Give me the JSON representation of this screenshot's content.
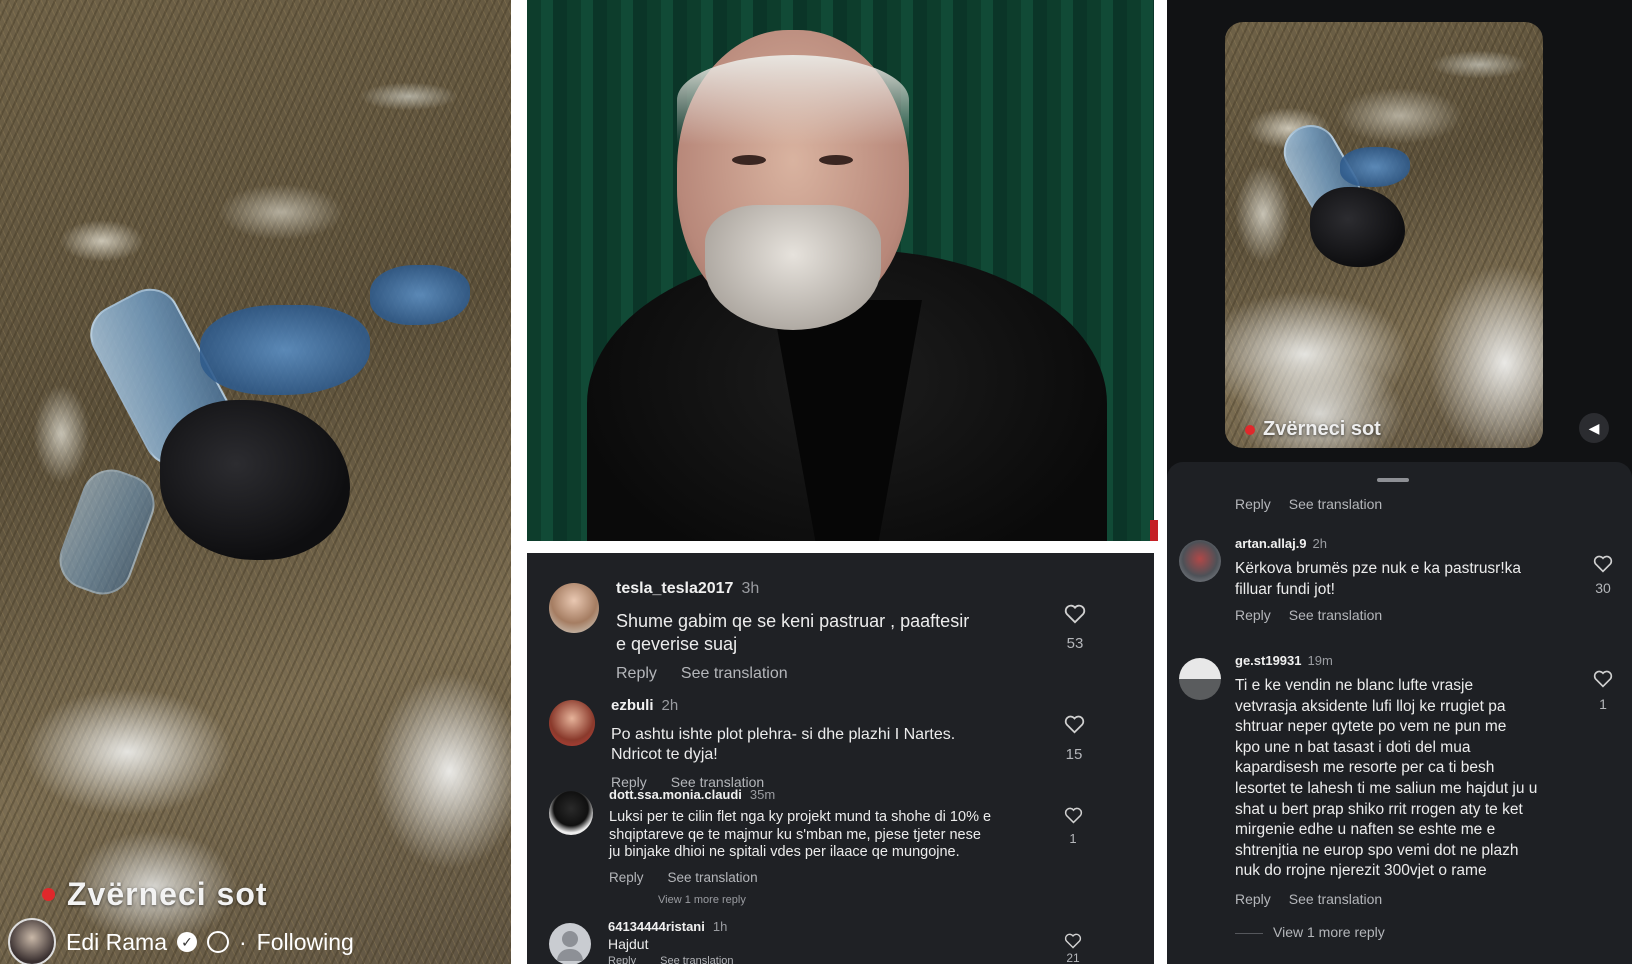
{
  "left_panel": {
    "location_label": "Zvërneci sot",
    "author": "Edi Rama",
    "separator": "·",
    "follow_status": "Following"
  },
  "middle_comments": [
    {
      "user": "tesla_tesla2017",
      "time": "3h",
      "text_lines": [
        "Shume gabim qe se keni pastruar , paaftesir",
        "e qeverise suaj"
      ],
      "likes": "53",
      "reply": "Reply",
      "translate": "See translation"
    },
    {
      "user": "ezbuli",
      "time": "2h",
      "text_lines": [
        "Po ashtu ishte plot plehra- si dhe plazhi I Nartes.",
        "Ndricot te dyja!"
      ],
      "likes": "15",
      "reply": "Reply",
      "translate": "See translation"
    },
    {
      "user": "dott.ssa.monia.claudi",
      "time": "35m",
      "text_lines": [
        "Luksi per te cilin flet nga ky projekt mund ta shohe di 10% e",
        "shqiptareve qe te majmur ku s'mban me, pjese tjeter nese",
        "ju binjake dhioi ne spitali vdes per ilaace qe mungojne."
      ],
      "likes": "1",
      "reply": "Reply",
      "translate": "See translation",
      "view_more": "View 1 more reply"
    },
    {
      "user": "64134444ristani",
      "time": "1h",
      "text_lines": [
        "Hajdut"
      ],
      "likes": "21",
      "reply": "Reply",
      "translate": "See translation"
    }
  ],
  "right_panel": {
    "video_label": "Zvërneci sot",
    "top_actions": {
      "reply": "Reply",
      "translate": "See translation"
    },
    "comments": [
      {
        "user": "artan.allaj.9",
        "time": "2h",
        "text_lines": [
          "Kërkova brumës pze nuk e ka pastrusr!ka",
          "filluar fundi jot!"
        ],
        "likes": "30",
        "reply": "Reply",
        "translate": "See translation"
      },
      {
        "user": "ge.st19931",
        "time": "19m",
        "text_lines": [
          "Ti e ke vendin ne blanc lufte vrasje",
          "vetvrasja aksidente lufi lloj ke rrugiet pa",
          "shtruar neper qytete po vem ne pun me",
          "kpo une n bat tasaзt i doti del mua",
          "kapardisesh me resorte per ca ti besh",
          "lesortet te lahesh ti me saliun me hajdut ju u",
          "shat u bert prap shiko rrit rrogen aty te ket",
          "mirgenie edhe u naften se eshte me e",
          "shtrenjtia ne europ spo vemi dot ne plazh",
          "nuk do rrojne njerezit 300vjet o rame"
        ],
        "likes": "1",
        "reply": "Reply",
        "translate": "See translation"
      }
    ],
    "view_more": "View 1 more reply"
  },
  "icons": {
    "heart": "heart-outline-icon",
    "verified": "verified-badge-icon",
    "globe": "globe-icon",
    "volume": "volume-icon",
    "live_dot": "red-dot-icon"
  },
  "colors": {
    "dark_bg": "#1f2125",
    "right_bg": "#111214",
    "live_red": "#e0282b",
    "curtain_green": "#114a36"
  }
}
